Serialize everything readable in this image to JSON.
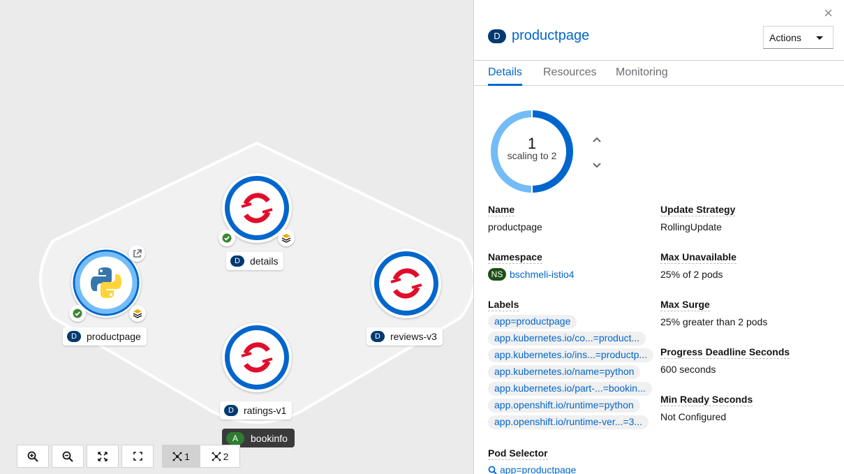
{
  "topology": {
    "application_group": {
      "badge": "A",
      "name": "bookinfo"
    },
    "nodes": [
      {
        "id": "productpage",
        "badge": "D",
        "name": "productpage",
        "runtime_icon": "python-icon"
      },
      {
        "id": "details",
        "badge": "D",
        "name": "details",
        "runtime_icon": "openshift-icon"
      },
      {
        "id": "reviews-v3",
        "badge": "D",
        "name": "reviews-v3",
        "runtime_icon": "openshift-icon"
      },
      {
        "id": "ratings-v1",
        "badge": "D",
        "name": "ratings-v1",
        "runtime_icon": "openshift-icon"
      }
    ],
    "toolbar": {
      "zoom_in_icon": "zoom-in-icon",
      "zoom_out_icon": "zoom-out-icon",
      "fit_icon": "fit-to-screen-icon",
      "reset_icon": "expand-icon",
      "layout1_label": "1",
      "layout2_label": "2"
    }
  },
  "panel": {
    "close_label": "×",
    "resource_badge": "D",
    "title": "productpage",
    "actions_label": "Actions",
    "tabs": [
      {
        "label": "Details"
      },
      {
        "label": "Resources"
      },
      {
        "label": "Monitoring"
      }
    ],
    "pod_ring": {
      "count": "1",
      "status": "scaling to 2",
      "fill": 0.5
    },
    "left_fields": {
      "name_label": "Name",
      "name_value": "productpage",
      "namespace_label": "Namespace",
      "namespace_badge": "NS",
      "namespace_value": "bschmeli-istio4",
      "labels_label": "Labels",
      "labels": [
        "app=productpage",
        "app.kubernetes.io/co...=product...",
        "app.kubernetes.io/ins...=productp...",
        "app.kubernetes.io/name=python",
        "app.kubernetes.io/part-...=bookin...",
        "app.openshift.io/runtime=python",
        "app.openshift.io/runtime-ver...=3..."
      ],
      "pod_selector_label": "Pod Selector",
      "pod_selector_value": "app=productpage"
    },
    "right_fields": {
      "update_strategy_label": "Update Strategy",
      "update_strategy_value": "RollingUpdate",
      "max_unavailable_label": "Max Unavailable",
      "max_unavailable_value": "25% of 2 pods",
      "max_surge_label": "Max Surge",
      "max_surge_value": "25% greater than 2 pods",
      "progress_deadline_label": "Progress Deadline Seconds",
      "progress_deadline_value": "600 seconds",
      "min_ready_label": "Min Ready Seconds",
      "min_ready_value": "Not Configured"
    }
  },
  "colors": {
    "accent": "#0066cc",
    "deployment_badge": "#003a70",
    "app_badge": "#2e7d32",
    "namespace_badge": "#1e4f18",
    "openshift_red": "#e00e2a",
    "ring_light": "#73bcf7"
  }
}
